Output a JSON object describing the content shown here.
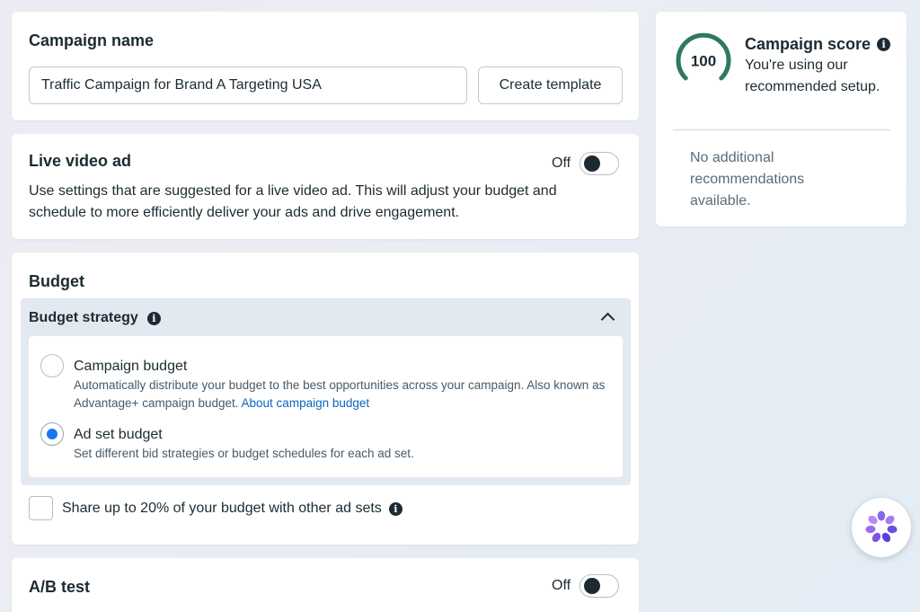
{
  "campaign_name": {
    "title": "Campaign name",
    "input_value": "Traffic Campaign for Brand A Targeting USA",
    "create_template_label": "Create template"
  },
  "live_video": {
    "title": "Live video ad",
    "toggle_label": "Off",
    "toggle_on": false,
    "description": "Use settings that are suggested for a live video ad. This will adjust your budget and schedule to more efficiently deliver your ads and drive engagement."
  },
  "budget": {
    "title": "Budget",
    "strategy_title": "Budget strategy",
    "options": [
      {
        "title": "Campaign budget",
        "description": "Automatically distribute your budget to the best opportunities across your campaign. Also known as Advantage+ campaign budget.",
        "link": "About campaign budget",
        "selected": false
      },
      {
        "title": "Ad set budget",
        "description": "Set different bid strategies or budget schedules for each ad set.",
        "selected": true
      }
    ],
    "share_label": "Share up to 20% of your budget with other ad sets",
    "share_checked": false
  },
  "ab_test": {
    "title": "A/B test",
    "toggle_label": "Off",
    "toggle_on": false
  },
  "score": {
    "value": "100",
    "title": "Campaign score",
    "subtitle": "You're using our recommended setup.",
    "no_recommendations": "No additional recommendations available.",
    "gauge_color": "#2f7a5a"
  },
  "colors": {
    "accent_blue": "#1877f2",
    "link_blue": "#0a66c2",
    "panel_bg": "#e3e9f1"
  }
}
